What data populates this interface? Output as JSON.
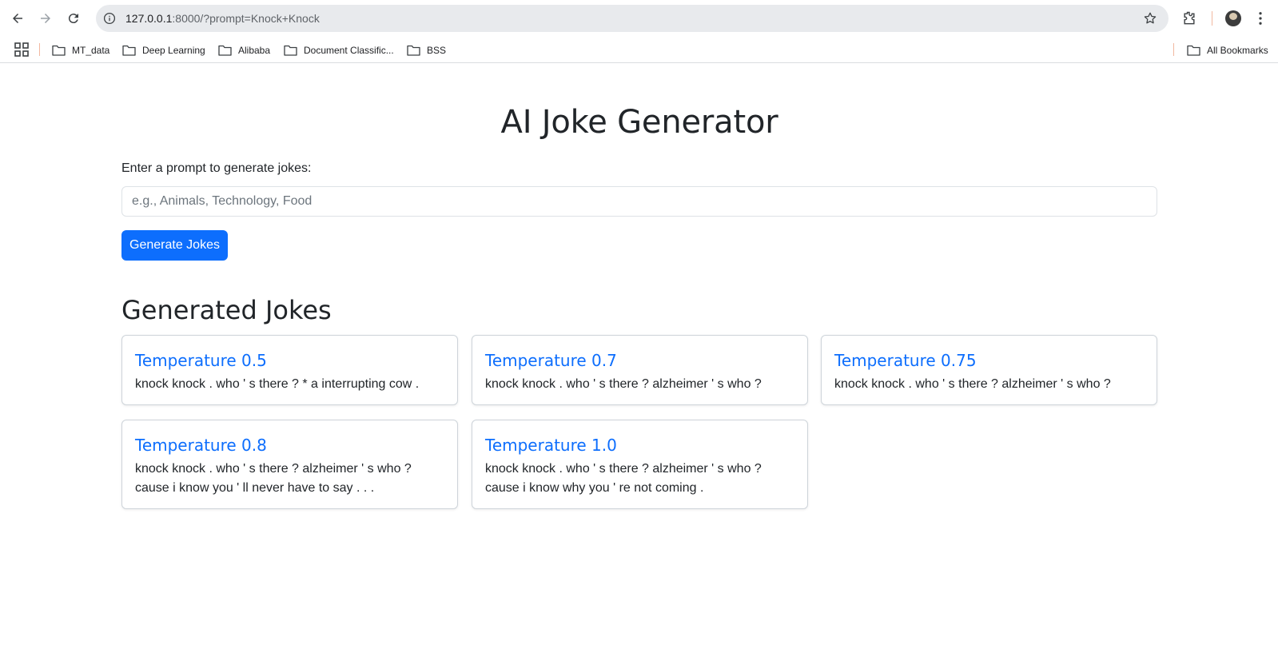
{
  "browser": {
    "url_host": "127.0.0.1",
    "url_rest": ":8000/?prompt=Knock+Knock",
    "bookmarks": [
      "MT_data",
      "Deep Learning",
      "Alibaba",
      "Document Classific...",
      "BSS"
    ],
    "all_bookmarks_label": "All Bookmarks"
  },
  "page": {
    "title": "AI Joke Generator",
    "prompt_label": "Enter a prompt to generate jokes:",
    "prompt_placeholder": "e.g., Animals, Technology, Food",
    "prompt_value": "",
    "generate_button": "Generate Jokes",
    "results_heading": "Generated Jokes"
  },
  "jokes": [
    {
      "title": "Temperature 0.5",
      "text": "knock knock . who ' s there ? * a interrupting cow ."
    },
    {
      "title": "Temperature 0.7",
      "text": "knock knock . who ' s there ? alzheimer ' s who ?"
    },
    {
      "title": "Temperature 0.75",
      "text": "knock knock . who ' s there ? alzheimer ' s who ?"
    },
    {
      "title": "Temperature 0.8",
      "text": "knock knock . who ' s there ? alzheimer ' s who ? cause i know you ' ll never have to say . . ."
    },
    {
      "title": "Temperature 1.0",
      "text": "knock knock . who ' s there ? alzheimer ' s who ? cause i know why you ' re not coming ."
    }
  ],
  "colors": {
    "accent": "#0d6efd",
    "text": "#212529"
  }
}
